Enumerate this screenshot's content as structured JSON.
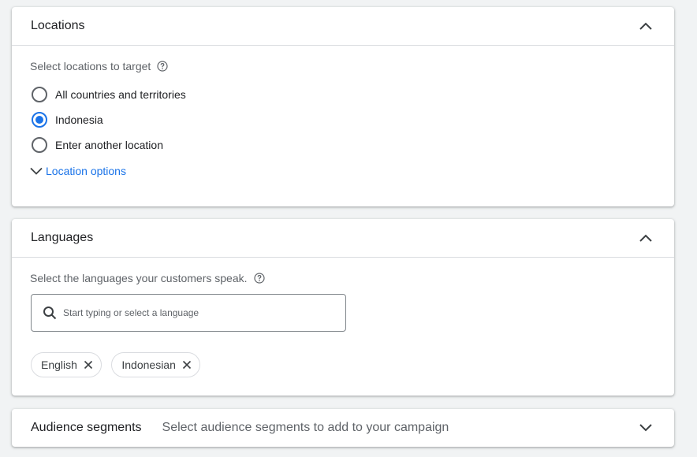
{
  "locations": {
    "title": "Locations",
    "prompt": "Select locations to target",
    "options": [
      {
        "label": "All countries and territories",
        "selected": false
      },
      {
        "label": "Indonesia",
        "selected": true
      },
      {
        "label": "Enter another location",
        "selected": false
      }
    ],
    "options_link": "Location options"
  },
  "languages": {
    "title": "Languages",
    "prompt": "Select the languages your customers speak.",
    "search_placeholder": "Start typing or select a language",
    "chips": [
      "English",
      "Indonesian"
    ]
  },
  "audience": {
    "title": "Audience segments",
    "subtitle": "Select audience segments to add to your campaign"
  },
  "colors": {
    "accent": "#1a73e8",
    "text": "#202124",
    "secondary": "#5f6368",
    "divider": "#dadce0"
  },
  "icons": {
    "collapse": "chevron-up-icon",
    "expand": "chevron-down-icon",
    "help": "help-circle-icon",
    "search": "search-icon",
    "remove": "close-icon"
  }
}
